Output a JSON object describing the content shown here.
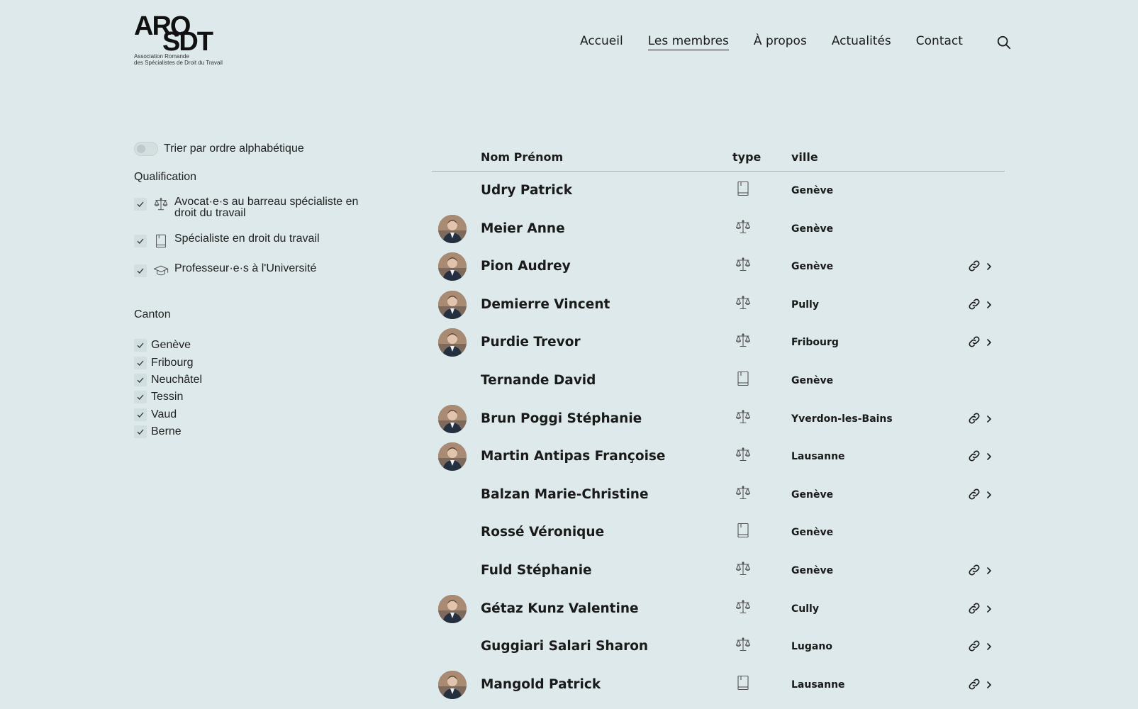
{
  "logo": {
    "line1": "ARO",
    "line2": "SDT",
    "sub1": "Association Romande",
    "sub2": "des Spécialistes de Droit du Travail"
  },
  "nav": {
    "items": [
      {
        "label": "Accueil",
        "active": false
      },
      {
        "label": "Les membres",
        "active": true
      },
      {
        "label": "À propos",
        "active": false
      },
      {
        "label": "Actualités",
        "active": false
      },
      {
        "label": "Contact",
        "active": false
      }
    ],
    "search_icon": "search-icon"
  },
  "filters": {
    "sort_label": "Trier par ordre alphabétique",
    "sort_enabled": false,
    "qualification_title": "Qualification",
    "qualifications": [
      {
        "label": "Avocat·e·s au barreau spécialiste en droit du travail",
        "icon": "scales-icon",
        "checked": true
      },
      {
        "label": "Spécialiste en droit du travail",
        "icon": "book-icon",
        "checked": true
      },
      {
        "label": "Professeur·e·s à l'Université",
        "icon": "graduation-cap-icon",
        "checked": true
      }
    ],
    "canton_title": "Canton",
    "cantons": [
      {
        "label": "Genève",
        "checked": true
      },
      {
        "label": "Fribourg",
        "checked": true
      },
      {
        "label": "Neuchâtel",
        "checked": true
      },
      {
        "label": "Tessin",
        "checked": true
      },
      {
        "label": "Vaud",
        "checked": true
      },
      {
        "label": "Berne",
        "checked": true
      }
    ]
  },
  "table": {
    "headers": {
      "name": "Nom Prénom",
      "type": "type",
      "city": "ville"
    },
    "rows": [
      {
        "name": "Udry Patrick",
        "type": "book",
        "city": "Genève",
        "photo": false,
        "link": false
      },
      {
        "name": "Meier Anne",
        "type": "scales",
        "city": "Genève",
        "photo": true,
        "link": false
      },
      {
        "name": "Pion Audrey",
        "type": "scales",
        "city": "Genève",
        "photo": true,
        "link": true
      },
      {
        "name": "Demierre Vincent",
        "type": "scales",
        "city": "Pully",
        "photo": true,
        "link": true
      },
      {
        "name": "Purdie Trevor",
        "type": "scales",
        "city": "Fribourg",
        "photo": true,
        "link": true
      },
      {
        "name": "Ternande David",
        "type": "book",
        "city": "Genève",
        "photo": false,
        "link": false
      },
      {
        "name": "Brun Poggi Stéphanie",
        "type": "scales",
        "city": "Yverdon-les-Bains",
        "photo": true,
        "link": true
      },
      {
        "name": "Martin Antipas Françoise",
        "type": "scales",
        "city": "Lausanne",
        "photo": true,
        "link": true
      },
      {
        "name": "Balzan Marie-Christine",
        "type": "scales",
        "city": "Genève",
        "photo": false,
        "link": true
      },
      {
        "name": "Rossé Véronique",
        "type": "book",
        "city": "Genève",
        "photo": false,
        "link": false
      },
      {
        "name": "Fuld Stéphanie",
        "type": "scales",
        "city": "Genève",
        "photo": false,
        "link": true
      },
      {
        "name": "Gétaz Kunz Valentine",
        "type": "scales",
        "city": "Cully",
        "photo": true,
        "link": true
      },
      {
        "name": "Guggiari Salari Sharon",
        "type": "scales",
        "city": "Lugano",
        "photo": false,
        "link": true
      },
      {
        "name": "Mangold Patrick",
        "type": "book",
        "city": "Lausanne",
        "photo": true,
        "link": true
      }
    ]
  },
  "colors": {
    "background": "#dde9ea",
    "text": "#1c1c1c",
    "icon": "#555555"
  }
}
